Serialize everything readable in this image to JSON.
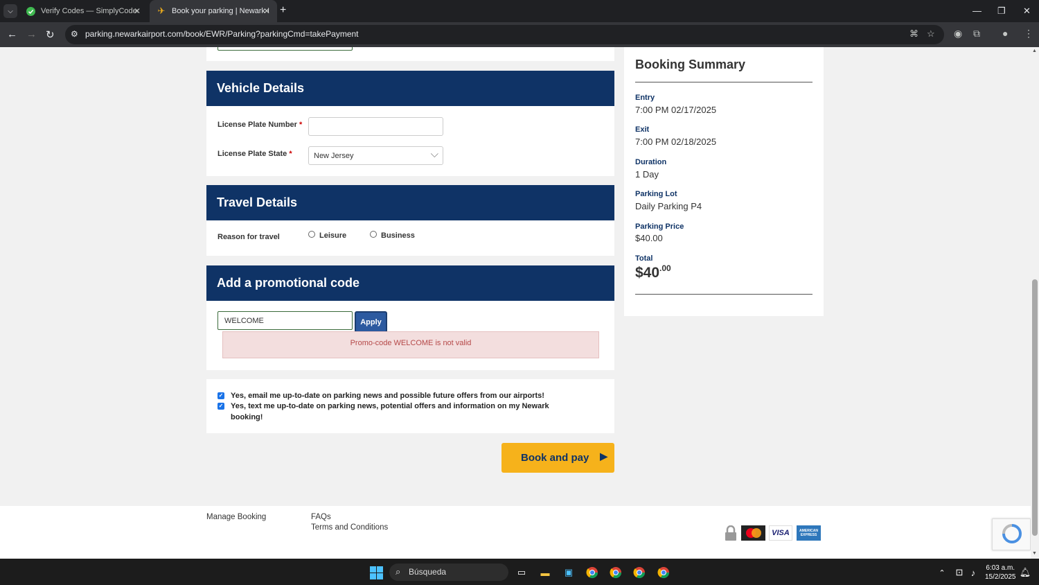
{
  "browser": {
    "tabs": [
      {
        "title": "Verify Codes — SimplyCodes",
        "active": false
      },
      {
        "title": "Book your parking | Newark Int",
        "active": true
      }
    ],
    "url": "parking.newarkairport.com/book/EWR/Parking?parkingCmd=takePayment"
  },
  "vehicle": {
    "heading": "Vehicle Details",
    "plate_number_label": "License Plate Number",
    "plate_number_value": "",
    "plate_state_label": "License Plate State",
    "plate_state_value": "New Jersey",
    "required_mark": "*"
  },
  "travel": {
    "heading": "Travel Details",
    "reason_label": "Reason for travel",
    "options": [
      "Leisure",
      "Business"
    ]
  },
  "promo": {
    "heading": "Add a promotional code",
    "code_value": "WELCOME",
    "apply_label": "Apply",
    "error": "Promo-code WELCOME is not valid"
  },
  "consent": {
    "email": "Yes, email me up-to-date on parking news and possible future offers from our airports!",
    "text_line1": "Yes, text me up-to-date on parking news, potential offers and information on my Newark",
    "text_line2": "booking!"
  },
  "book_button": "Book and pay",
  "summary": {
    "heading": "Booking Summary",
    "entry_label": "Entry",
    "entry_value": "7:00 PM 02/17/2025",
    "exit_label": "Exit",
    "exit_value": "7:00 PM 02/18/2025",
    "duration_label": "Duration",
    "duration_value": "1 Day",
    "lot_label": "Parking Lot",
    "lot_value": "Daily Parking P4",
    "price_label": "Parking Price",
    "price_value": "$40.00",
    "total_label": "Total",
    "total_main": "$40",
    "total_cents": ".00"
  },
  "footer": {
    "manage_booking": "Manage Booking",
    "faqs": "FAQs",
    "terms": "Terms and Conditions",
    "visa": "VISA",
    "amex": "AMERICAN EXPRESS"
  },
  "taskbar": {
    "search_placeholder": "Búsqueda",
    "time": "6:03 a.m.",
    "date": "15/2/2025"
  },
  "colors": {
    "header_blue": "#0f3366",
    "book_orange": "#f6b21b",
    "error_bg": "#f3dede",
    "error_text": "#b54848"
  }
}
